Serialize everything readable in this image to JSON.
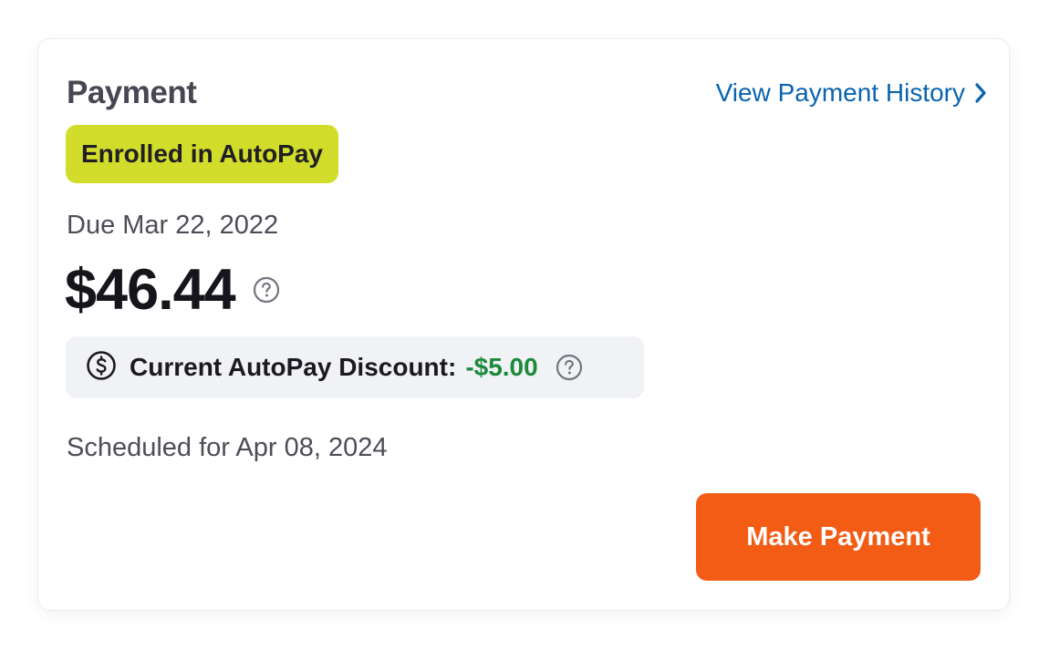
{
  "payment": {
    "title": "Payment",
    "history_link": "View Payment History",
    "autopay_badge": "Enrolled in AutoPay",
    "due_text": "Due Mar 22, 2022",
    "amount": "$46.44",
    "discount_label": "Current AutoPay Discount:",
    "discount_value": "-$5.00",
    "scheduled_text": "Scheduled for Apr 08, 2024",
    "make_payment_label": "Make Payment"
  },
  "icons": {
    "history_chevron": "chevron-right-icon",
    "amount_help": "question-circle-icon",
    "discount_dollar": "dollar-circle-icon",
    "discount_help": "question-circle-icon"
  },
  "colors": {
    "link": "#0a64b0",
    "badge_bg": "#d2dc2a",
    "discount_positive": "#1c8a3a",
    "primary_button": "#f25c14",
    "discount_box_bg": "#f1f2f6"
  }
}
